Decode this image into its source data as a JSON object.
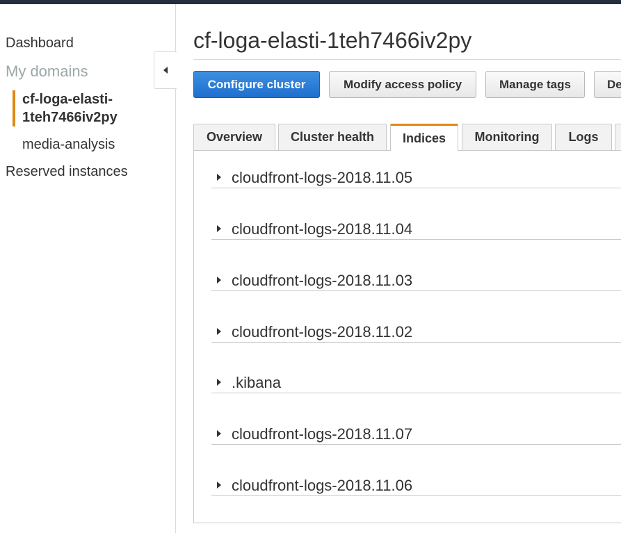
{
  "sidebar": {
    "dashboard": "Dashboard",
    "my_domains": "My domains",
    "domains": [
      {
        "label": "cf-loga-elasti-\n1teh7466iv2py",
        "line1": "cf-loga-elasti-",
        "line2": "1teh7466iv2py",
        "active": true
      },
      {
        "label": "media-analysis",
        "active": false
      }
    ],
    "reserved": "Reserved instances",
    "collapse_icon": "chevron-left-icon"
  },
  "header": {
    "title": "cf-loga-elasti-1teh7466iv2py"
  },
  "toolbar": {
    "configure": "Configure cluster",
    "modify_policy": "Modify access policy",
    "manage_tags": "Manage tags",
    "delete": "De"
  },
  "tabs": [
    {
      "label": "Overview",
      "active": false
    },
    {
      "label": "Cluster health",
      "active": false
    },
    {
      "label": "Indices",
      "active": true
    },
    {
      "label": "Monitoring",
      "active": false
    },
    {
      "label": "Logs",
      "active": false
    }
  ],
  "indices": [
    "cloudfront-logs-2018.11.05",
    "cloudfront-logs-2018.11.04",
    "cloudfront-logs-2018.11.03",
    "cloudfront-logs-2018.11.02",
    ".kibana",
    "cloudfront-logs-2018.11.07",
    "cloudfront-logs-2018.11.06"
  ],
  "colors": {
    "accent": "#dd8a14",
    "primary": "#1f6fce",
    "topbar": "#232f3e"
  }
}
